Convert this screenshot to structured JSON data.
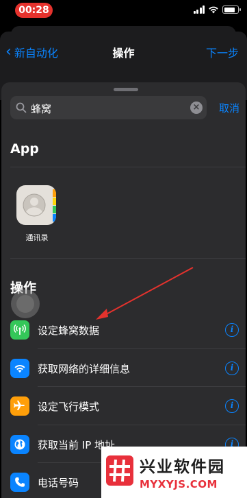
{
  "status_bar": {
    "time": "00:28",
    "time_color": "#e5322d"
  },
  "nav": {
    "back_label": "新自动化",
    "title": "操作",
    "next_label": "下一步"
  },
  "search": {
    "query": "蜂窝",
    "cancel_label": "取消"
  },
  "apps_section": {
    "title": "App",
    "apps": [
      {
        "label": "通讯录",
        "icon": "contacts-icon"
      }
    ]
  },
  "actions_section": {
    "title": "操作",
    "items": [
      {
        "label": "设定蜂窝数据",
        "icon": "cellular-antenna-icon",
        "color": "#34c759"
      },
      {
        "label": "获取网络的详细信息",
        "icon": "wifi-icon",
        "color": "#0a84ff"
      },
      {
        "label": "设定飞行模式",
        "icon": "airplane-icon",
        "color": "#ff9f0a"
      },
      {
        "label": "获取当前 IP 地址",
        "icon": "globe-icon",
        "color": "#0a84ff"
      },
      {
        "label": "电话号码",
        "icon": "phone-icon",
        "color": "#0a84ff"
      }
    ]
  },
  "watermark": {
    "title": "兴业软件园",
    "subtitle": "MYXYJS.COM",
    "logo_color": "#e8303b"
  },
  "accent_color": "#0a84ff"
}
